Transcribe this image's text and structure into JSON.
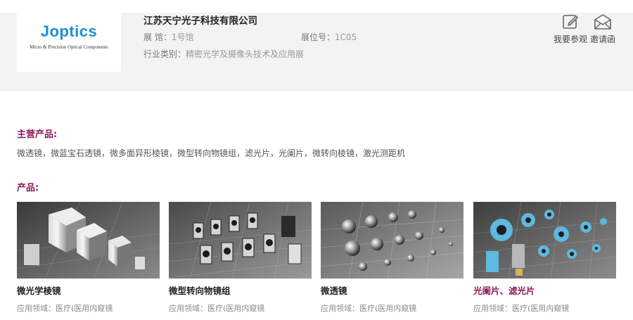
{
  "company": {
    "logo_text": "Joptics",
    "logo_tagline": "Micro & Precision Optical Components",
    "name": "江苏天宁光子科技有限公司",
    "hall_label": "展 馆：",
    "hall_value": "1号馆",
    "booth_label": "展位号：",
    "booth_value": "1C05",
    "industry_label": "行业类别：",
    "industry_value": "精密光学及摄像头技术及应用展"
  },
  "actions": [
    {
      "label": "我要参观",
      "icon": "edit-icon"
    },
    {
      "label": "邀请函",
      "icon": "envelope-icon"
    }
  ],
  "main_products": {
    "title": "主营产品:",
    "text": "微透镜，微蓝宝石透镜，微多面异形棱镜，微型转向物镜组，滤光片，光阑片，微转向棱镜，激光测距机"
  },
  "products": {
    "title": "产品:",
    "items": [
      {
        "name": "微光学棱镜",
        "field": "应用领域：医疗(医用内窥镜",
        "selected": false
      },
      {
        "name": "微型转向物镜组",
        "field": "应用领域：医疗(医用内窥镜",
        "selected": false
      },
      {
        "name": "微透镜",
        "field": "应用领域：医疗(医用内窥镜",
        "selected": false
      },
      {
        "name": "光阑片、滤光片",
        "field": "应用领域：医疗(医用内窥镜",
        "selected": true
      }
    ]
  },
  "colors": {
    "accent": "#8b1a5b",
    "logo_blue": "#1b8fd6",
    "header_bg": "#f3f3f3"
  }
}
